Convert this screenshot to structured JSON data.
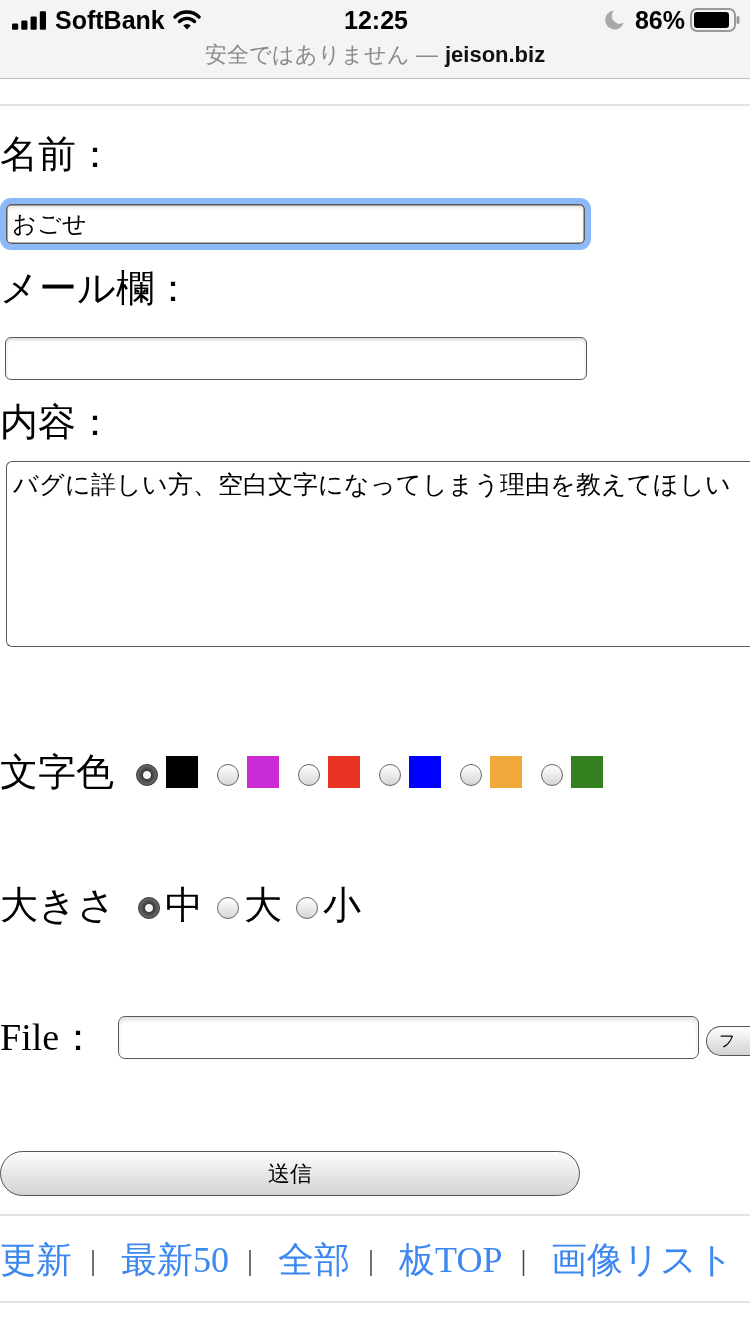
{
  "status_bar": {
    "carrier": "SoftBank",
    "time": "12:25",
    "do_not_disturb": true,
    "battery": "86%"
  },
  "address_bar": {
    "security_note": "安全ではありません —",
    "domain": "jeison.biz"
  },
  "fields": [
    {
      "kind": "input",
      "label": "名前：",
      "value": "おごせ",
      "focused": true
    },
    {
      "kind": "input",
      "label": "メール欄：",
      "focused": false
    },
    {
      "kind": "textarea",
      "label": "内容：",
      "value": "バグに詳しい方、空白文字になってしまう理由を教えてほしい",
      "focused": false
    }
  ],
  "text_color": {
    "label": "文字色",
    "options": [
      {
        "color": "#000000",
        "selected": true
      },
      {
        "color": "#c92bd6",
        "selected": false
      },
      {
        "color": "#e83323",
        "selected": false
      },
      {
        "color": "#0000ff",
        "selected": false
      },
      {
        "color": "#f0a83a",
        "selected": false
      },
      {
        "color": "#347f20",
        "selected": false
      }
    ]
  },
  "size": {
    "label": "大きさ",
    "options": [
      {
        "label": "中",
        "selected": true
      },
      {
        "label": "大",
        "selected": false
      },
      {
        "label": "小",
        "selected": false
      }
    ]
  },
  "file": {
    "label": "File：",
    "button": "フ"
  },
  "submit": "送信",
  "links": [
    {
      "label": "更新",
      "separator": "|"
    },
    {
      "label": "最新50",
      "separator": "|"
    },
    {
      "label": "全部",
      "separator": "|"
    },
    {
      "label": "板TOP",
      "separator": "|"
    },
    {
      "label": "画像リスト"
    }
  ]
}
